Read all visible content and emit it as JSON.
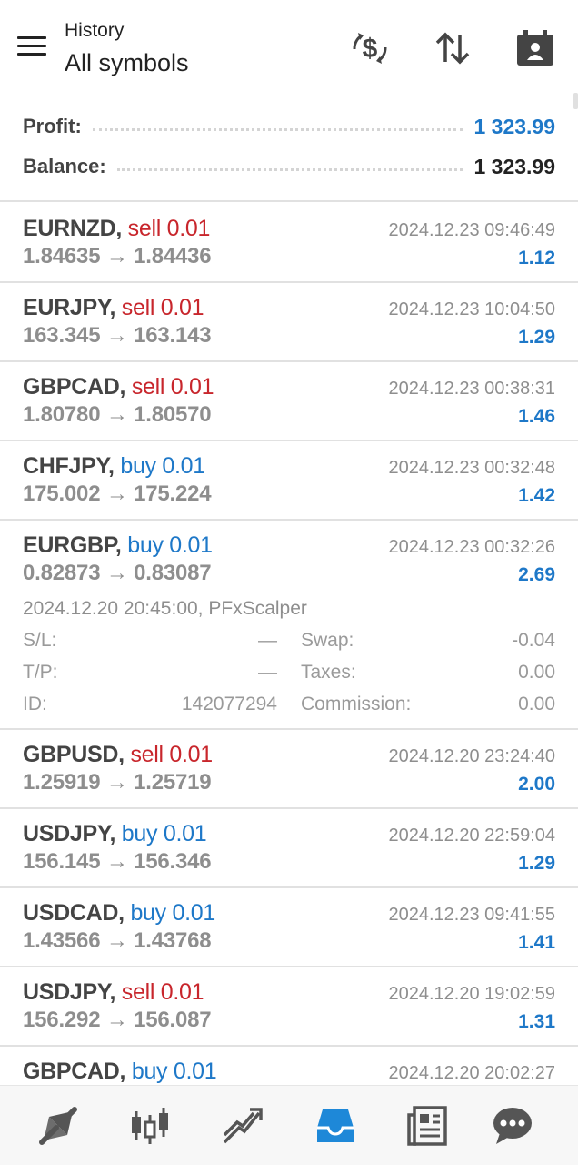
{
  "header": {
    "subtitle": "History",
    "title": "All symbols"
  },
  "summary": {
    "profit_label": "Profit:",
    "profit_value": "1 323.99",
    "balance_label": "Balance:",
    "balance_value": "1 323.99"
  },
  "trades": [
    {
      "symbol": "EURNZD,",
      "direction": "sell 0.01",
      "prices": "1.84635 → 1.84436",
      "time": "2024.12.23 09:46:49",
      "profit": "1.12"
    },
    {
      "symbol": "EURJPY,",
      "direction": "sell 0.01",
      "prices": "163.345 → 163.143",
      "time": "2024.12.23 10:04:50",
      "profit": "1.29"
    },
    {
      "symbol": "GBPCAD,",
      "direction": "sell 0.01",
      "prices": "1.80780 → 1.80570",
      "time": "2024.12.23 00:38:31",
      "profit": "1.46"
    },
    {
      "symbol": "CHFJPY,",
      "direction": "buy 0.01",
      "prices": "175.002 → 175.224",
      "time": "2024.12.23 00:32:48",
      "profit": "1.42"
    },
    {
      "symbol": "EURGBP,",
      "direction": "buy 0.01",
      "prices": "0.82873 → 0.83087",
      "time": "2024.12.23 00:32:26",
      "profit": "2.69",
      "details": {
        "open_info": "2024.12.20 20:45:00, PFxScalper",
        "sl_label": "S/L:",
        "sl_value": "—",
        "tp_label": "T/P:",
        "tp_value": "—",
        "id_label": "ID:",
        "id_value": "142077294",
        "swap_label": "Swap:",
        "swap_value": "-0.04",
        "taxes_label": "Taxes:",
        "taxes_value": "0.00",
        "commission_label": "Commission:",
        "commission_value": "0.00"
      }
    },
    {
      "symbol": "GBPUSD,",
      "direction": "sell 0.01",
      "prices": "1.25919 → 1.25719",
      "time": "2024.12.20 23:24:40",
      "profit": "2.00"
    },
    {
      "symbol": "USDJPY,",
      "direction": "buy 0.01",
      "prices": "156.145 → 156.346",
      "time": "2024.12.20 22:59:04",
      "profit": "1.29"
    },
    {
      "symbol": "USDCAD,",
      "direction": "buy 0.01",
      "prices": "1.43566 → 1.43768",
      "time": "2024.12.23 09:41:55",
      "profit": "1.41"
    },
    {
      "symbol": "USDJPY,",
      "direction": "sell 0.01",
      "prices": "156.292 → 156.087",
      "time": "2024.12.20 19:02:59",
      "profit": "1.31"
    },
    {
      "symbol": "GBPCAD,",
      "direction": "buy 0.01",
      "prices": "",
      "time": "2024.12.20 20:02:27",
      "profit": ""
    }
  ],
  "icons": {
    "header": [
      "currency-exchange-icon",
      "sort-icon",
      "calendar-icon"
    ],
    "nav": [
      "quotes-icon",
      "chart-icon",
      "trade-icon",
      "history-icon",
      "news-icon",
      "messages-icon"
    ]
  },
  "colors": {
    "accent": "#1e78c8",
    "sell": "#c8262c",
    "buy": "#1e78c8",
    "muted": "#8e8e8e"
  }
}
